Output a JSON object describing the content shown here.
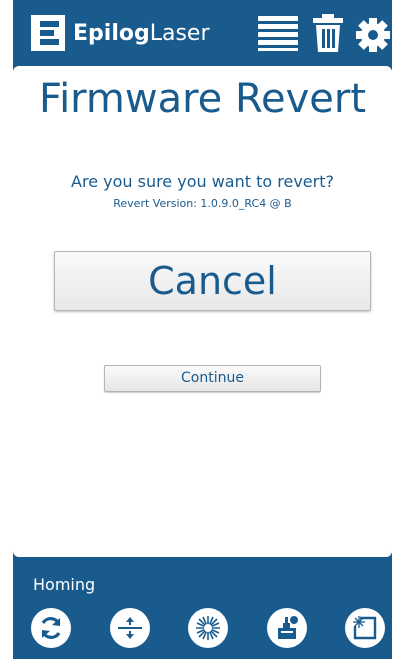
{
  "app": {
    "logo_bold": "Epilog",
    "logo_light": "Laser",
    "header_icons": [
      "list-icon",
      "trash-icon",
      "gear-icon"
    ]
  },
  "page": {
    "title": "Firmware Revert",
    "question": "Are you sure you want to revert?",
    "version_text": "Revert Version: 1.0.9.0_RC4 @ B",
    "cancel_label": "Cancel",
    "continue_label": "Continue"
  },
  "status": {
    "text": "Homing"
  },
  "toolbar": {
    "icons": [
      "refresh-icon",
      "jog-icon",
      "laser-pointer-icon",
      "focus-icon",
      "job-origin-icon"
    ]
  },
  "colors": {
    "brand_blue": "#1a5b8e",
    "white": "#ffffff",
    "button_gray": "#ececec"
  }
}
